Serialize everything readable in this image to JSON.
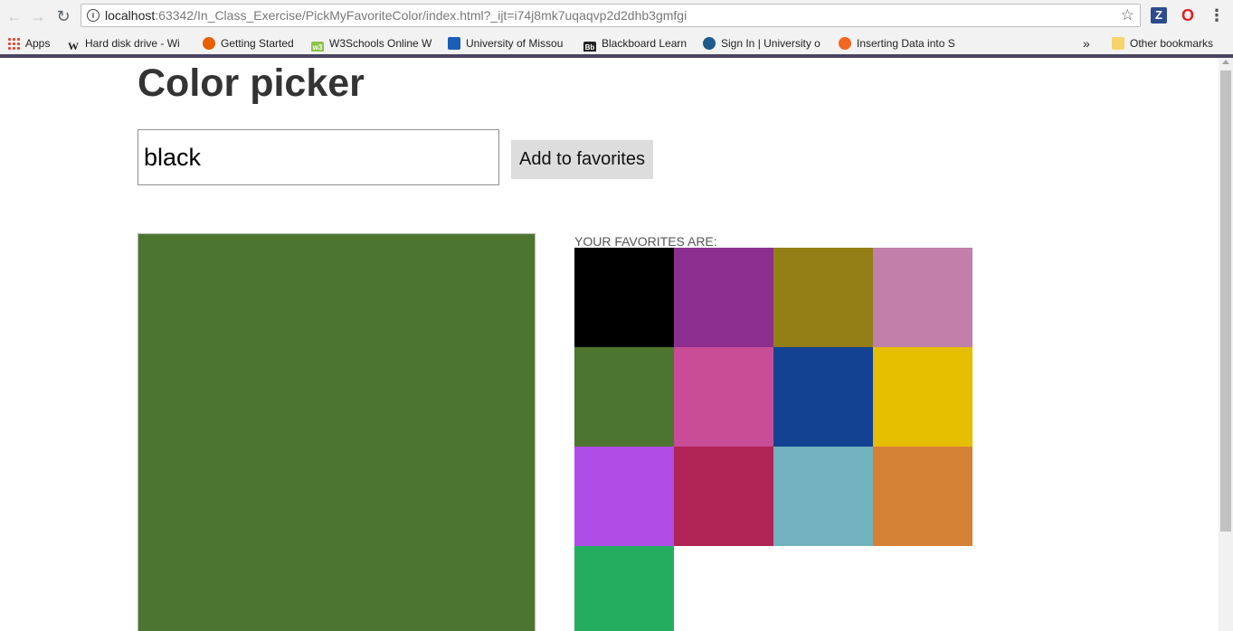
{
  "browser": {
    "url_host": "localhost",
    "url_rest": ":63342/In_Class_Exercise/PickMyFavoriteColor/index.html?_ijt=i74j8mk7uqaqvp2d2dhb3gmfgi",
    "back_icon": "←",
    "forward_icon": "→",
    "reload_icon": "↻",
    "info_icon": "i",
    "star_icon": "☆",
    "ext_z_label": "Z",
    "ext_opera_label": "O",
    "menu_icon": "⋮"
  },
  "bookmarks": {
    "items": [
      {
        "label": "Apps"
      },
      {
        "label": "Hard disk drive - Wi",
        "icon": "W"
      },
      {
        "label": "Getting Started"
      },
      {
        "label": "W3Schools Online W",
        "icon": "w3"
      },
      {
        "label": "University of Missou"
      },
      {
        "label": "Blackboard Learn",
        "icon": "Bb"
      },
      {
        "label": "Sign In | University o"
      },
      {
        "label": "Inserting Data into S"
      }
    ],
    "overflow_icon": "»",
    "other_label": "Other bookmarks"
  },
  "page": {
    "title": "Color picker",
    "input_value": "black",
    "add_button_label": "Add to favorites",
    "preview_color": "#4c752f",
    "favorites_label": "YOUR FAVORITES ARE:",
    "favorites": [
      "#000000",
      "#8b2e8f",
      "#947f17",
      "#c17fa9",
      "#4c752f",
      "#c94c96",
      "#134293",
      "#e6be00",
      "#b04de6",
      "#b02456",
      "#72b2be",
      "#d58236",
      "#24ad5e"
    ]
  }
}
